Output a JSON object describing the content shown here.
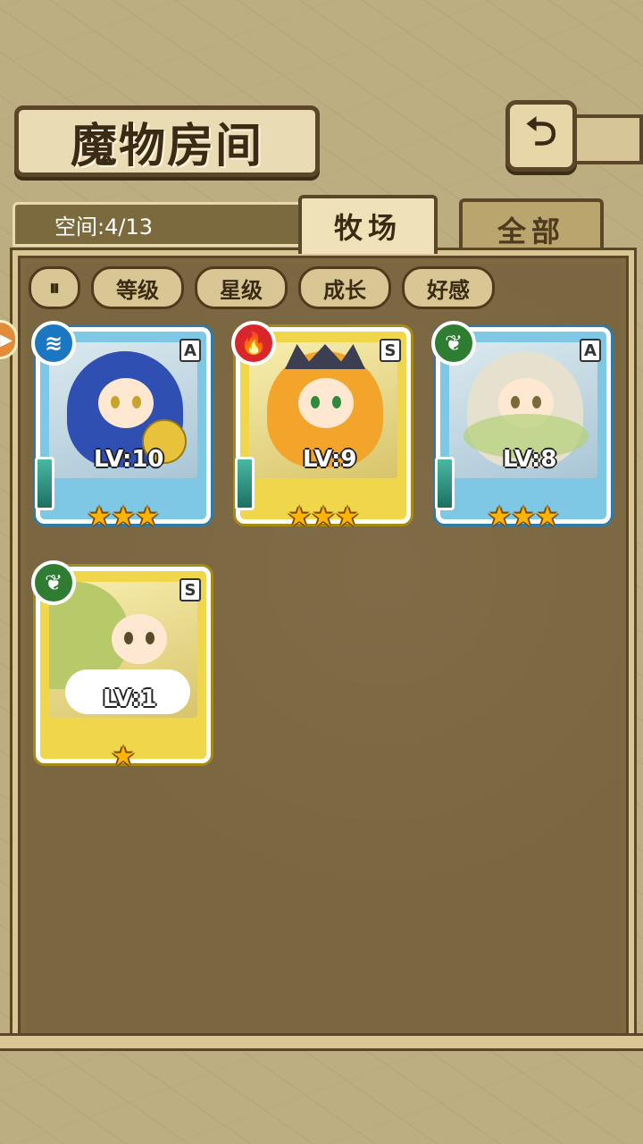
{
  "header": {
    "title": "魔物房间",
    "back_icon": "return-arrow-icon"
  },
  "storage": {
    "space_text": "空间:4/13"
  },
  "tabs": [
    {
      "label": "牧场",
      "active": true
    },
    {
      "label": "全部",
      "active": false
    }
  ],
  "sort": {
    "toggle_label": "⏸",
    "buttons": [
      "等级",
      "星级",
      "成长",
      "好感"
    ]
  },
  "monsters": [
    {
      "element": "water",
      "element_icon": "≋",
      "rank": "A",
      "level": "LV:10",
      "stars": 3,
      "frame": "blue"
    },
    {
      "element": "fire",
      "element_icon": "🔥",
      "rank": "S",
      "level": "LV:9",
      "stars": 3,
      "frame": "gold"
    },
    {
      "element": "wood",
      "element_icon": "❦",
      "rank": "A",
      "level": "LV:8",
      "stars": 3,
      "frame": "blue"
    },
    {
      "element": "wood",
      "element_icon": "❦",
      "rank": "S",
      "level": "LV:1",
      "stars": 1,
      "frame": "gold"
    }
  ],
  "colors": {
    "water": "#1b77c2",
    "fire": "#d8262b",
    "wood": "#2e7d32",
    "star": "#ffb400"
  }
}
